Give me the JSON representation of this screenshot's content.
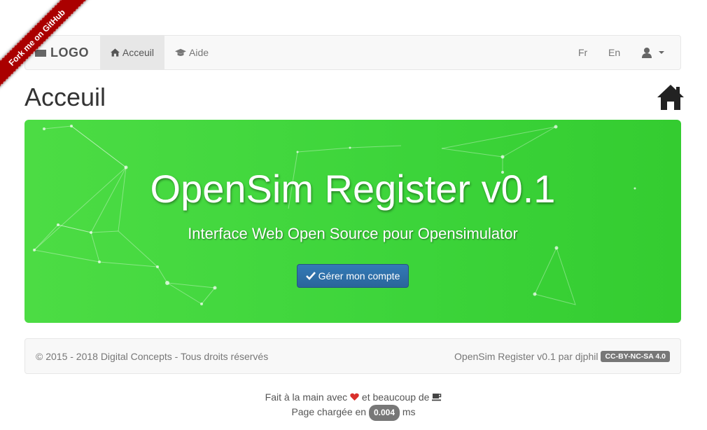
{
  "ribbon": {
    "label": "Fork me on GitHub"
  },
  "navbar": {
    "brand": "LOGO",
    "items": [
      {
        "label": "Acceuil",
        "icon": "home-icon",
        "active": true
      },
      {
        "label": "Aide",
        "icon": "graduation-cap-icon",
        "active": false
      }
    ],
    "lang": [
      "Fr",
      "En"
    ],
    "user_icon": "user-icon"
  },
  "page": {
    "title": "Acceuil",
    "title_icon": "home-icon"
  },
  "jumbotron": {
    "heading": "OpenSim Register v0.1",
    "subheading": "Interface Web Open Source pour Opensimulator",
    "button_label": "Gérer mon compte",
    "button_icon": "check-icon",
    "bg_color": "#3ed43a"
  },
  "footer": {
    "copyright": "© 2015 - 2018 Digital Concepts - Tous droits réservés",
    "credit": "OpenSim Register v0.1 par djphil",
    "license": "CC-BY-NC-SA 4.0"
  },
  "credits": {
    "line1_pre": "Fait à la main avec",
    "line1_mid": "et beaucoup de",
    "line2_pre": "Page chargée en",
    "load_time": "0.004",
    "line2_post": "ms"
  },
  "colors": {
    "accent": "#337ab7",
    "ribbon": "#aa0000",
    "heart": "#d9302c"
  }
}
